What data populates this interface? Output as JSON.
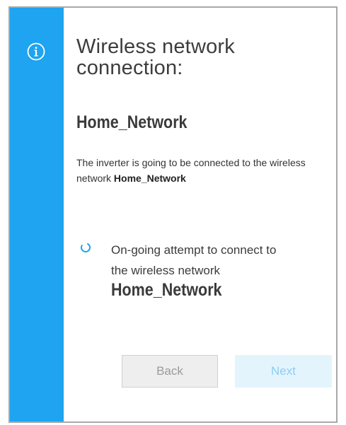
{
  "dialog": {
    "title": "Wireless network connection:",
    "title_line1": "Wireless network",
    "title_line2": "connection:",
    "network_name": "Home_Network",
    "description_prefix": "The inverter is going to be connected to the wireless network",
    "description_network": "Home_Network",
    "status_line1": "On-going attempt to connect to",
    "status_line2": "the wireless network",
    "status_network": "Home_Network",
    "icon": "info-icon",
    "spinner_icon": "loading-spinner-icon"
  },
  "buttons": {
    "back_label": "Back",
    "next_label": "Next"
  },
  "colors": {
    "accent": "#1ea4f0",
    "title_text": "#3d3d3d",
    "back_bg": "#eeeeee",
    "next_bg": "#e4f4fd",
    "next_text": "#8ecdf2"
  }
}
